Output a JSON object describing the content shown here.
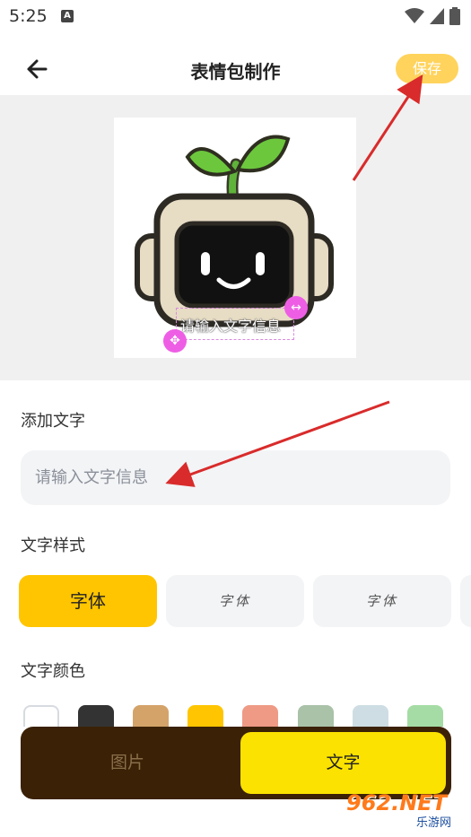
{
  "status_bar": {
    "time": "5:25",
    "notification_letter": "A"
  },
  "header": {
    "title": "表情包制作",
    "save_label": "保存"
  },
  "preview": {
    "overlay_text": "请输入文字信息",
    "resize_icon": "↔",
    "move_icon": "✥"
  },
  "add_text": {
    "label": "添加文字",
    "placeholder": "请输入文字信息",
    "value": ""
  },
  "text_style": {
    "label": "文字样式",
    "options": [
      "字体",
      "字体",
      "字体"
    ],
    "selected_index": 0
  },
  "text_color": {
    "label": "文字颜色",
    "swatches": [
      "#ffffff",
      "#333333",
      "#d4a36a",
      "#ffc500",
      "#ee9a85",
      "#a9c2a8",
      "#cddde3",
      "#a5dca5"
    ]
  },
  "bottom_tabs": {
    "image": "图片",
    "text": "文字",
    "selected": "text"
  },
  "watermark": {
    "main": "962.NET",
    "sub": "乐游网"
  },
  "colors": {
    "accent": "#ffc500",
    "save_button": "#ffd35c",
    "bottom_bar": "#3b2106",
    "active_tab": "#fbe200",
    "handle": "#ee5ee5",
    "annotation_arrow": "#d92b2b"
  }
}
